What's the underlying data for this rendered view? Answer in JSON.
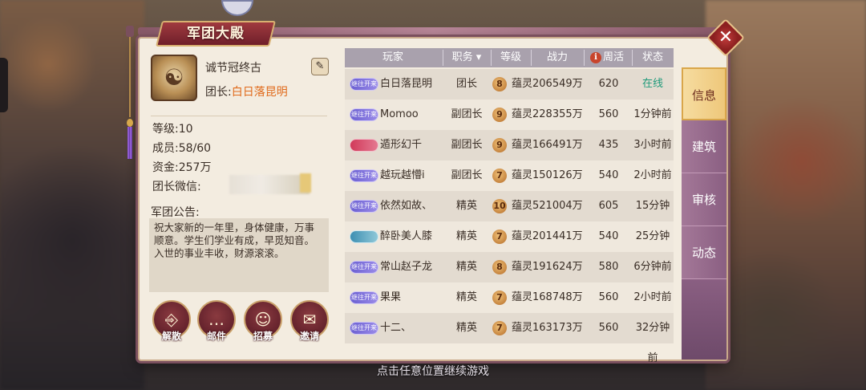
{
  "panel": {
    "title": "军团大殿",
    "close_label": "✕"
  },
  "guild": {
    "name": "诚节冠终古",
    "leader_label": "团长:",
    "leader_name": "白日落昆明",
    "level_label": "等级:",
    "level_value": "10",
    "members_label": "成员:",
    "members_value": "58/60",
    "funds_label": "资金:",
    "funds_value": "257万",
    "wechat_label": "团长微信:",
    "notice_label": "军团公告:",
    "notice_text": "祝大家新的一年里，身体健康，万事顺意。学生们学业有成，早觅知音。入世的事业丰收，财源滚滚。"
  },
  "actions": [
    {
      "label": "解散",
      "icon": "door-exit-icon"
    },
    {
      "label": "邮件",
      "icon": "mail-bubble-icon"
    },
    {
      "label": "招募",
      "icon": "recruit-person-icon"
    },
    {
      "label": "邀请",
      "icon": "invite-letter-icon"
    }
  ],
  "table": {
    "headers": {
      "player": "玩家",
      "role": "职务",
      "level": "等级",
      "power": "战力",
      "weekly": "周活",
      "status": "状态"
    },
    "rows": [
      {
        "badge": "继往开来",
        "badge_color": "purple",
        "name": "白日落昆明",
        "role": "团长",
        "level": "8",
        "power": "蕴灵206549万",
        "weekly": "620",
        "status": "在线",
        "online": true
      },
      {
        "badge": "继往开来",
        "badge_color": "purple",
        "name": "Momoo",
        "role": "副团长",
        "level": "9",
        "power": "蕴灵228355万",
        "weekly": "560",
        "status": "1分钟前",
        "online": false
      },
      {
        "badge": "",
        "badge_color": "red",
        "name": "遁形幻千",
        "role": "副团长",
        "level": "9",
        "power": "蕴灵166491万",
        "weekly": "435",
        "status": "3小时前",
        "online": false
      },
      {
        "badge": "继往开来",
        "badge_color": "purple",
        "name": "越玩越懵i",
        "role": "副团长",
        "level": "7",
        "power": "蕴灵150126万",
        "weekly": "540",
        "status": "2小时前",
        "online": false
      },
      {
        "badge": "继往开来",
        "badge_color": "purple",
        "name": "依然如故、",
        "role": "精英",
        "level": "10",
        "power": "蕴灵521004万",
        "weekly": "605",
        "status": "15分钟前",
        "online": false
      },
      {
        "badge": "",
        "badge_color": "teal",
        "name": "醉卧美人膝",
        "role": "精英",
        "level": "7",
        "power": "蕴灵201441万",
        "weekly": "540",
        "status": "25分钟前",
        "online": false
      },
      {
        "badge": "继往开来",
        "badge_color": "purple",
        "name": "常山赵子龙",
        "role": "精英",
        "level": "8",
        "power": "蕴灵191624万",
        "weekly": "580",
        "status": "6分钟前",
        "online": false
      },
      {
        "badge": "继往开来",
        "badge_color": "purple",
        "name": "果果",
        "role": "精英",
        "level": "7",
        "power": "蕴灵168748万",
        "weekly": "560",
        "status": "2小时前",
        "online": false
      },
      {
        "badge": "继往开来",
        "badge_color": "purple",
        "name": "十二、",
        "role": "精英",
        "level": "7",
        "power": "蕴灵163173万",
        "weekly": "560",
        "status": "32分钟前",
        "online": false
      }
    ]
  },
  "tabs": [
    "信息",
    "建筑",
    "审核",
    "动态"
  ],
  "footer_hint": "点击任意位置继续游戏",
  "colors": {
    "accent": "#e06a1b",
    "online": "#1f9a7a",
    "tab_active": "#eec77a"
  }
}
